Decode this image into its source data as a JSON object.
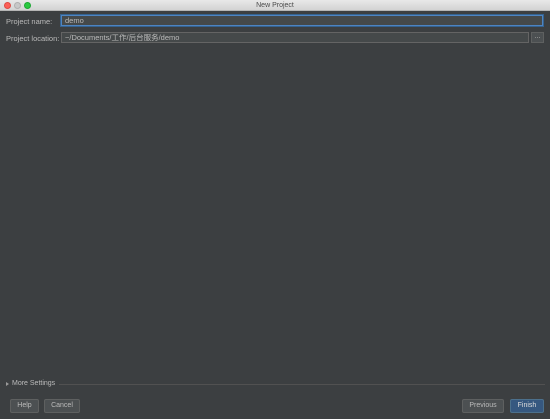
{
  "window": {
    "title": "New Project"
  },
  "form": {
    "project_name_label": "Project name:",
    "project_name_value": "demo",
    "project_location_label": "Project location:",
    "project_location_value": "~/Documents/工作/后台服务/demo",
    "browse_label": "..."
  },
  "more_settings": {
    "label": "More Settings"
  },
  "buttons": {
    "help": "Help",
    "cancel": "Cancel",
    "previous": "Previous",
    "finish": "Finish"
  },
  "colors": {
    "background": "#3c3f41",
    "focus_border": "#4d84c2",
    "primary_button": "#365880"
  }
}
